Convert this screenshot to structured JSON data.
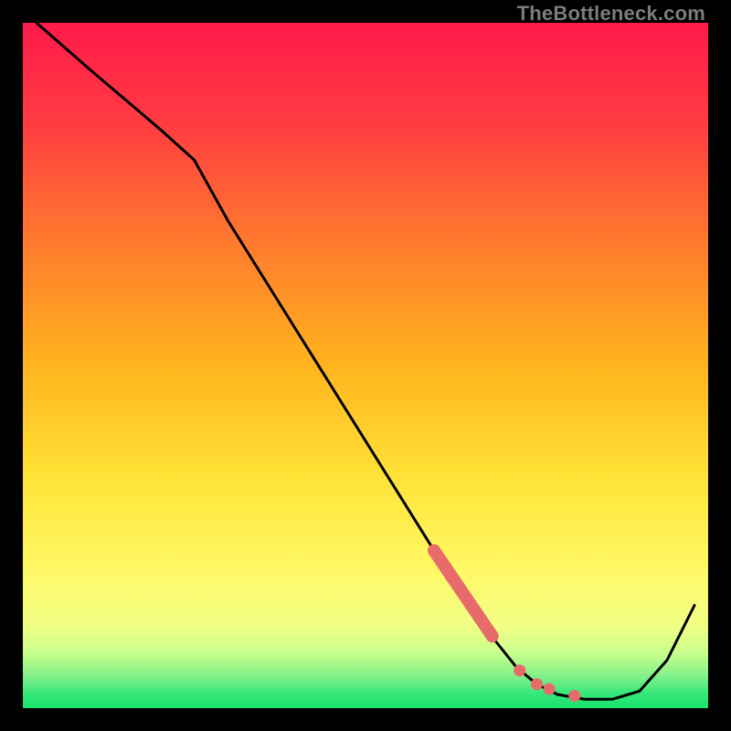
{
  "watermark": "TheBottleneck.com",
  "colors": {
    "background": "#000000",
    "gradient_top": "#ff1a4a",
    "gradient_mid": "#ffd600",
    "gradient_bottom_band": "#f6ff8c",
    "gradient_bottom": "#17e36a",
    "line": "#000000",
    "marker": "#e86b6b"
  },
  "chart_data": {
    "type": "line",
    "title": "",
    "xlabel": "",
    "ylabel": "",
    "xlim": [
      0,
      100
    ],
    "ylim": [
      0,
      100
    ],
    "series": [
      {
        "name": "curve",
        "x": [
          2,
          10,
          20,
          25,
          30,
          40,
          50,
          60,
          64,
          68,
          72,
          75,
          78,
          82,
          86,
          90,
          94,
          98
        ],
        "y": [
          100,
          93,
          84.5,
          80,
          71,
          55,
          39,
          23,
          17,
          11,
          6,
          3.5,
          2,
          1.3,
          1.3,
          2.5,
          7,
          15
        ]
      }
    ],
    "highlight_segment": {
      "name": "thick-marker-segment",
      "x": [
        60,
        68.5
      ],
      "y": [
        23,
        10.5
      ]
    },
    "marker_points": [
      {
        "x": 72.5,
        "y": 5.5
      },
      {
        "x": 75.0,
        "y": 3.5
      },
      {
        "x": 76.8,
        "y": 2.8
      },
      {
        "x": 80.5,
        "y": 1.8
      }
    ],
    "grid": false,
    "legend": false
  }
}
